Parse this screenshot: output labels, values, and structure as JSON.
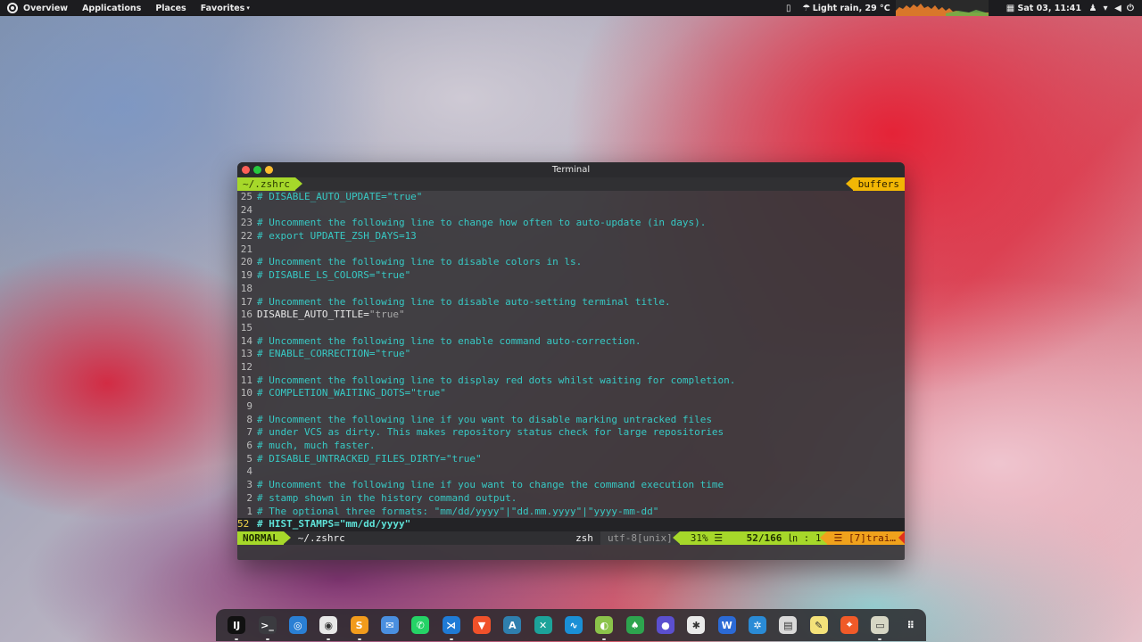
{
  "topbar": {
    "menus": [
      {
        "label": "Overview"
      },
      {
        "label": "Applications"
      },
      {
        "label": "Places"
      },
      {
        "label": "Favorites"
      }
    ],
    "weather": "Light rain, 29 °C",
    "clock": "Sat 03, 11:41"
  },
  "window": {
    "title": "Terminal",
    "tab_file": "~/.zshrc",
    "tab_buffers": "buffers",
    "lines": [
      {
        "num": "25",
        "text": "# DISABLE_AUTO_UPDATE=\"true\""
      },
      {
        "num": "24",
        "text": ""
      },
      {
        "num": "23",
        "text": "# Uncomment the following line to change how often to auto-update (in days)."
      },
      {
        "num": "22",
        "text": "# export UPDATE_ZSH_DAYS=13"
      },
      {
        "num": "21",
        "text": ""
      },
      {
        "num": "20",
        "text": "# Uncomment the following line to disable colors in ls."
      },
      {
        "num": "19",
        "text": "# DISABLE_LS_COLORS=\"true\""
      },
      {
        "num": "18",
        "text": ""
      },
      {
        "num": "17",
        "text": "# Uncomment the following line to disable auto-setting terminal title."
      },
      {
        "num": "16",
        "code": "DISABLE_AUTO_TITLE=",
        "str": "\"true\""
      },
      {
        "num": "15",
        "text": ""
      },
      {
        "num": "14",
        "text": "# Uncomment the following line to enable command auto-correction."
      },
      {
        "num": "13",
        "text": "# ENABLE_CORRECTION=\"true\""
      },
      {
        "num": "12",
        "text": ""
      },
      {
        "num": "11",
        "text": "# Uncomment the following line to display red dots whilst waiting for completion."
      },
      {
        "num": "10",
        "text": "# COMPLETION_WAITING_DOTS=\"true\""
      },
      {
        "num": "9",
        "text": ""
      },
      {
        "num": "8",
        "text": "# Uncomment the following line if you want to disable marking untracked files"
      },
      {
        "num": "7",
        "text": "# under VCS as dirty. This makes repository status check for large repositories"
      },
      {
        "num": "6",
        "text": "# much, much faster."
      },
      {
        "num": "5",
        "text": "# DISABLE_UNTRACKED_FILES_DIRTY=\"true\""
      },
      {
        "num": "4",
        "text": ""
      },
      {
        "num": "3",
        "text": "# Uncomment the following line if you want to change the command execution time"
      },
      {
        "num": "2",
        "text": "# stamp shown in the history command output."
      },
      {
        "num": "1",
        "text": "# The optional three formats: \"mm/dd/yyyy\"|\"dd.mm.yyyy\"|\"yyyy-mm-dd\""
      },
      {
        "num": "52",
        "text": "# HIST_STAMPS=\"mm/dd/yyyy\"",
        "current": true
      }
    ],
    "status": {
      "mode": "NORMAL",
      "file": "~/.zshrc",
      "filetype": "zsh",
      "encoding": "utf-8[unix]",
      "percent": "31% ☰",
      "position": "52/166",
      "column": "㏑ :  1",
      "warning": "☰ [7]trai…"
    }
  },
  "dock": {
    "apps": [
      {
        "icon": "intellij-icon",
        "glyph": "IJ",
        "bg": "#111111",
        "running": true
      },
      {
        "icon": "terminal-icon",
        "glyph": ">_",
        "bg": "#3b3b40",
        "running": true
      },
      {
        "icon": "browser-swirl-icon",
        "glyph": "◎",
        "bg": "#2a7fd4",
        "running": false
      },
      {
        "icon": "chrome-icon",
        "glyph": "◉",
        "bg": "#e8e8e8",
        "running": true
      },
      {
        "icon": "sublime-icon",
        "glyph": "S",
        "bg": "#f29b1c",
        "running": true
      },
      {
        "icon": "messenger-icon",
        "glyph": "✉",
        "bg": "#4a8fe0",
        "running": false
      },
      {
        "icon": "whatsapp-icon",
        "glyph": "✆",
        "bg": "#25d366",
        "running": false
      },
      {
        "icon": "vscode-icon",
        "glyph": "⋊",
        "bg": "#1f7bd6",
        "running": true
      },
      {
        "icon": "brave-icon",
        "glyph": "▼",
        "bg": "#f0512a",
        "running": false
      },
      {
        "icon": "android-studio-icon",
        "glyph": "A",
        "bg": "#2f7fae",
        "running": false
      },
      {
        "icon": "xcode-icon",
        "glyph": "✕",
        "bg": "#1ca39a",
        "running": false
      },
      {
        "icon": "monitor-icon",
        "glyph": "∿",
        "bg": "#1a8fd6",
        "running": false
      },
      {
        "icon": "android-icon",
        "glyph": "◐",
        "bg": "#8bc34a",
        "running": true
      },
      {
        "icon": "leaf-icon",
        "glyph": "♠",
        "bg": "#2da44e",
        "running": false
      },
      {
        "icon": "eclipse-icon",
        "glyph": "●",
        "bg": "#5b4fcf",
        "running": false
      },
      {
        "icon": "slack-icon",
        "glyph": "✱",
        "bg": "#e9e9e9",
        "running": false
      },
      {
        "icon": "word-icon",
        "glyph": "W",
        "bg": "#2b6ad6",
        "running": false
      },
      {
        "icon": "settings-gear-icon",
        "glyph": "✲",
        "bg": "#2a8bd6",
        "running": false
      },
      {
        "icon": "archive-icon",
        "glyph": "▤",
        "bg": "#d9d9d9",
        "running": false
      },
      {
        "icon": "notes-icon",
        "glyph": "✎",
        "bg": "#f4e27a",
        "running": false
      },
      {
        "icon": "compass-icon",
        "glyph": "⌖",
        "bg": "#f05a28",
        "running": false
      },
      {
        "icon": "files-icon",
        "glyph": "▭",
        "bg": "#d6d6c4",
        "running": true
      },
      {
        "icon": "app-grid-icon",
        "glyph": "⠿",
        "bg": "transparent",
        "running": false
      }
    ]
  },
  "colors": {
    "accent_green": "#a6d82a",
    "accent_orange": "#f2b705",
    "comment_cyan": "#37c9c4"
  }
}
